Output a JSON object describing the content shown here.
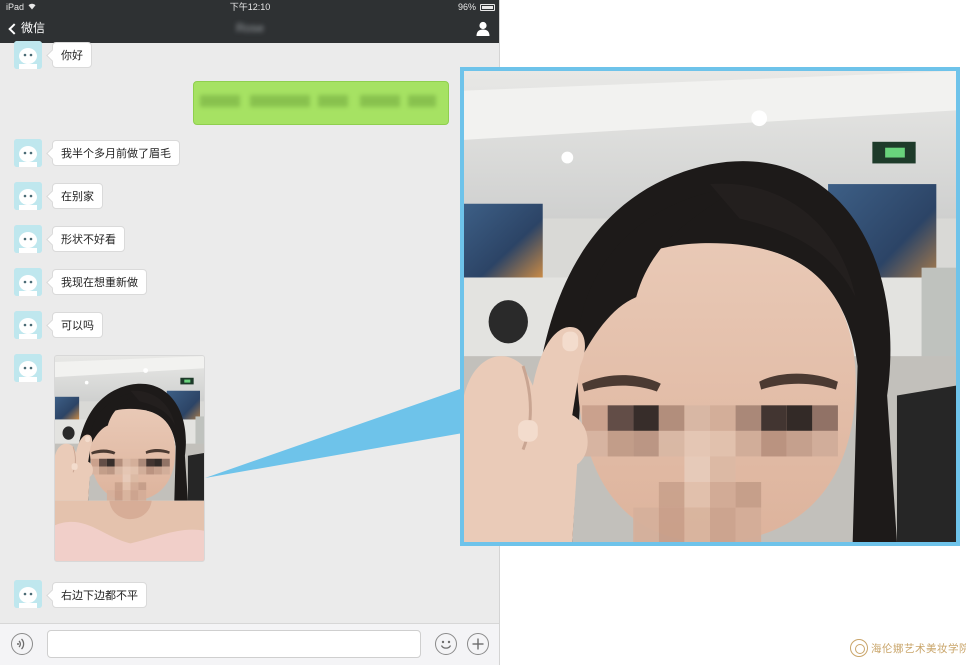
{
  "status_bar": {
    "device": "iPad",
    "time": "下午12:10",
    "battery": "96%"
  },
  "nav": {
    "back_label": "微信",
    "title": "Rose"
  },
  "messages": [
    {
      "from": "contact",
      "type": "text",
      "text": "你好"
    },
    {
      "from": "me",
      "type": "text",
      "text": ""
    },
    {
      "from": "contact",
      "type": "text",
      "text": "我半个多月前做了眉毛"
    },
    {
      "from": "contact",
      "type": "text",
      "text": "在别家"
    },
    {
      "from": "contact",
      "type": "text",
      "text": "形状不好看"
    },
    {
      "from": "contact",
      "type": "text",
      "text": "我现在想重新做"
    },
    {
      "from": "contact",
      "type": "text",
      "text": "可以吗"
    },
    {
      "from": "contact",
      "type": "image",
      "text": ""
    },
    {
      "from": "contact",
      "type": "text",
      "text": "右边下边都不平"
    }
  ],
  "input": {
    "placeholder": ""
  },
  "icons": {
    "back": "chevron-left-icon",
    "profile": "person-icon",
    "voice": "voice-icon",
    "emoji": "emoji-icon",
    "plus": "plus-icon"
  },
  "colors": {
    "nav_bg": "#2e3133",
    "chat_bg": "#ebebeb",
    "sent_bubble": "#a6e263",
    "callout_border": "#6ec3ea",
    "avatar_bg": "#bfe7ee"
  },
  "watermark": {
    "text": "海伦娜艺术美妆学院"
  }
}
